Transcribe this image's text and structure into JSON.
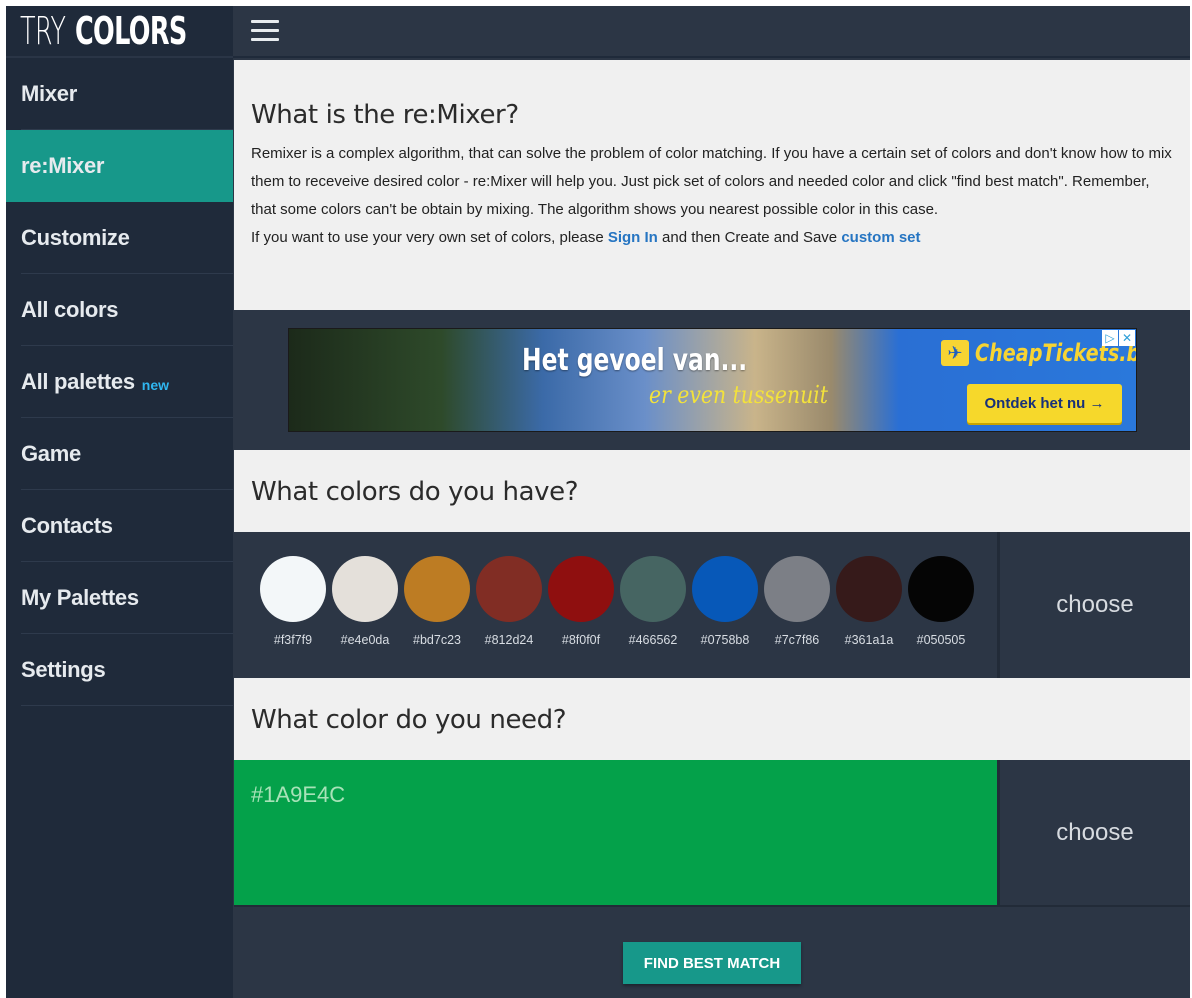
{
  "app": {
    "logo_light": "TRY",
    "logo_bold": "COLORS"
  },
  "sidebar": {
    "items": [
      {
        "label": "Mixer",
        "badge": "",
        "active": false
      },
      {
        "label": "re:Mixer",
        "badge": "",
        "active": true
      },
      {
        "label": "Customize",
        "badge": "",
        "active": false
      },
      {
        "label": "All colors",
        "badge": "",
        "active": false
      },
      {
        "label": "All palettes",
        "badge": "new",
        "active": false
      },
      {
        "label": "Game",
        "badge": "",
        "active": false
      },
      {
        "label": "Contacts",
        "badge": "",
        "active": false
      },
      {
        "label": "My Palettes",
        "badge": "",
        "active": false
      },
      {
        "label": "Settings",
        "badge": "",
        "active": false
      }
    ]
  },
  "topbar": {
    "menu_icon": "hamburger-menu-icon"
  },
  "intro": {
    "title": "What is the re:Mixer?",
    "body": "Remixer is a complex algorithm, that can solve the problem of color matching. If you have a certain set of colors and don't know how to mix them to receveive desired color - re:Mixer will help you. Just pick set of colors and needed color and click \"find best match\". Remember, that some colors can't be obtain by mixing. The algorithm shows you nearest possible color in this case.",
    "custom_pre": "If you want to use your very own set of colors, please ",
    "sign_in": "Sign In",
    "custom_mid": " and then Create and Save ",
    "custom_set": "custom set"
  },
  "ad": {
    "headline": "Het gevoel van...",
    "subline": "er even tussenuit",
    "brand": "CheapTickets.be",
    "cta": "Ontdek het nu →",
    "choices_icon": "▷",
    "close_icon": "✕",
    "plane_icon": "✈"
  },
  "have": {
    "title": "What colors do you have?",
    "choose": "choose",
    "swatches": [
      {
        "hex": "#f3f7f9"
      },
      {
        "hex": "#e4e0da"
      },
      {
        "hex": "#bd7c23"
      },
      {
        "hex": "#812d24"
      },
      {
        "hex": "#8f0f0f"
      },
      {
        "hex": "#466562"
      },
      {
        "hex": "#0758b8"
      },
      {
        "hex": "#7c7f86"
      },
      {
        "hex": "#361a1a"
      },
      {
        "hex": "#050505"
      }
    ]
  },
  "need": {
    "title": "What color do you need?",
    "hex": "#1A9E4C",
    "choose": "choose"
  },
  "actions": {
    "find": "FIND BEST MATCH"
  }
}
